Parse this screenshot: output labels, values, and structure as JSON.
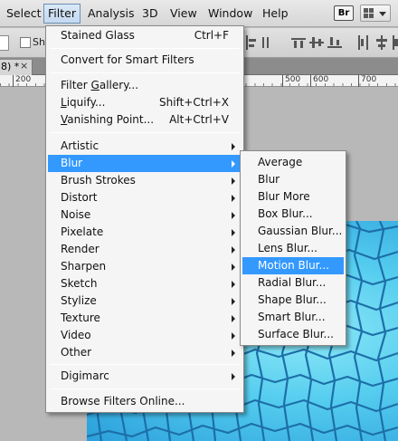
{
  "menubar": {
    "items": [
      "Select",
      "Filter",
      "Analysis",
      "3D",
      "View",
      "Window",
      "Help"
    ],
    "bridge_badge": "Br"
  },
  "options": {
    "checkbox_label": "Sh"
  },
  "document": {
    "tab_label": "8) *",
    "close_glyph": "×",
    "ruler_marks": [
      "200",
      "500",
      "600",
      "700"
    ]
  },
  "filter_menu": {
    "last_filter": {
      "label": "Stained Glass",
      "shortcut": "Ctrl+F"
    },
    "convert": "Convert for Smart Filters",
    "gallery": {
      "hotkey": "G",
      "rest": "allery..."
    },
    "liquify": {
      "hotkey": "L",
      "rest": "iquify...",
      "shortcut": "Shift+Ctrl+X"
    },
    "vanishing": {
      "hotkey": "V",
      "rest": "anishing Point...",
      "shortcut": "Alt+Ctrl+V"
    },
    "submenus": [
      "Artistic",
      "Blur",
      "Brush Strokes",
      "Distort",
      "Noise",
      "Pixelate",
      "Render",
      "Sharpen",
      "Sketch",
      "Stylize",
      "Texture",
      "Video",
      "Other"
    ],
    "highlighted": "Blur",
    "digimarc": "Digimarc",
    "browse": "Browse Filters Online..."
  },
  "blur_menu": {
    "items": [
      "Average",
      "Blur",
      "Blur More",
      "Box Blur...",
      "Gaussian Blur...",
      "Lens Blur...",
      "Motion Blur...",
      "Radial Blur...",
      "Shape Blur...",
      "Smart Blur...",
      "Surface Blur..."
    ],
    "highlighted": "Motion Blur..."
  },
  "colors": {
    "highlight": "#3399ff",
    "menu_bg": "#f5f5f5",
    "canvas_texture": "#55cdef"
  }
}
